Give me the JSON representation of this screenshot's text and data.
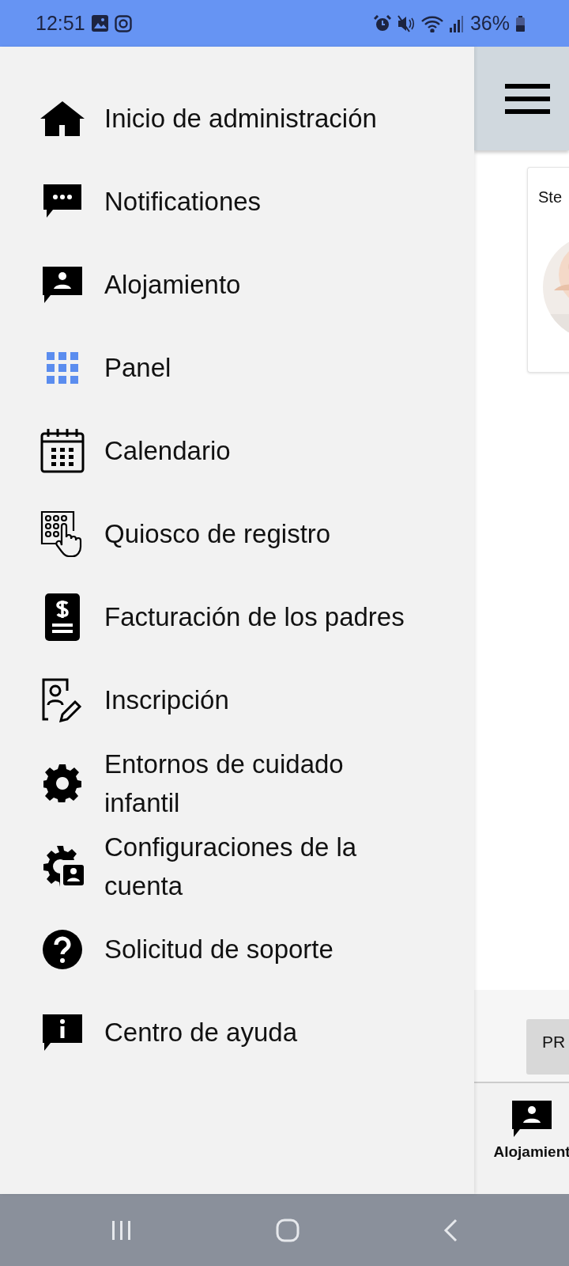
{
  "status_bar": {
    "time": "12:51",
    "battery": "36%"
  },
  "drawer": {
    "items": [
      {
        "label": "Inicio de administración",
        "kind": "home",
        "selected": false
      },
      {
        "label": "Notificationes",
        "kind": "chat-dots",
        "selected": false
      },
      {
        "label": "Alojamiento",
        "kind": "chat-person",
        "selected": false
      },
      {
        "label": "Panel",
        "kind": "grid",
        "selected": true
      },
      {
        "label": "Calendario",
        "kind": "calendar",
        "selected": false
      },
      {
        "label": "Quiosco de registro",
        "kind": "keypad",
        "selected": false
      },
      {
        "label": "Facturación de los padres",
        "kind": "bill",
        "selected": false
      },
      {
        "label": "Inscripción",
        "kind": "person-edit",
        "selected": false
      },
      {
        "label": "Entornos de cuidado infantil",
        "kind": "gear",
        "selected": false
      },
      {
        "label": "Configuraciones de la cuenta",
        "kind": "gear-person",
        "selected": false
      },
      {
        "label": "Solicitud de soporte",
        "kind": "help",
        "selected": false
      },
      {
        "label": "Centro de ayuda",
        "kind": "chat-info",
        "selected": false
      }
    ]
  },
  "card": {
    "name": "Ste"
  },
  "footer_button": "PR",
  "bottom_nav": {
    "label": "Alojamient"
  }
}
